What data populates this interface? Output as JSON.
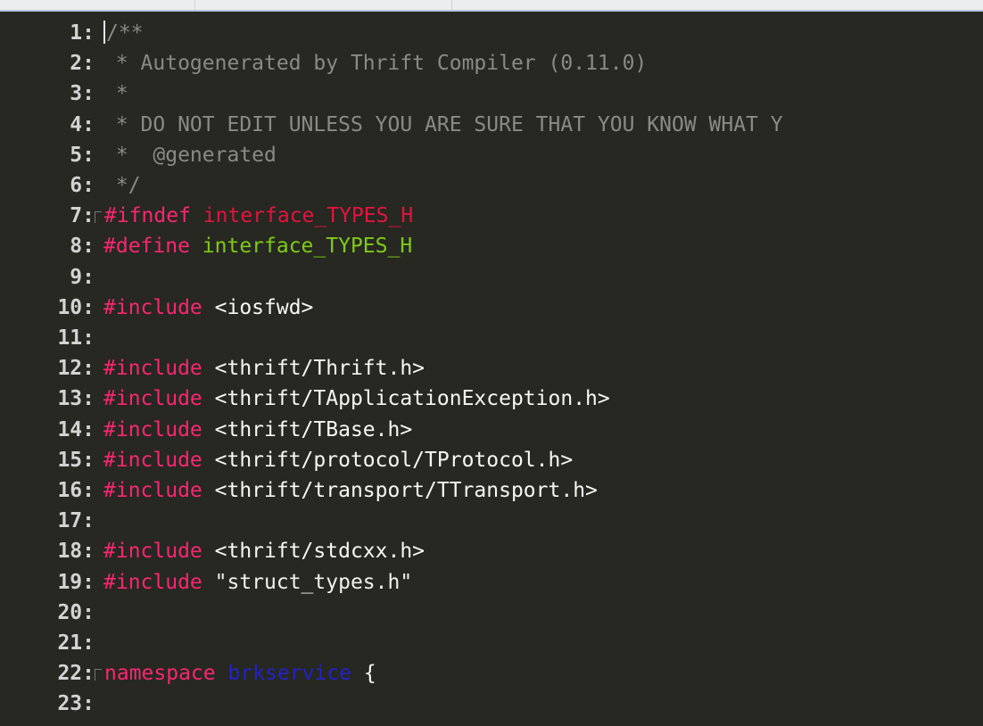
{
  "colors": {
    "background": "#272822",
    "line_number": "#d3d3d3",
    "comment": "#8a8a86",
    "directive": "#f92672",
    "ifndef_name": "#e4143c",
    "define_name": "#7fcb15",
    "namespace_name": "#2222c9",
    "text": "#f8f8f2"
  },
  "editor": {
    "lines": [
      {
        "number": "1:",
        "parts": [
          {
            "text": "/**",
            "style": "comment"
          }
        ]
      },
      {
        "number": "2:",
        "parts": [
          {
            "text": " * Autogenerated by Thrift Compiler (0.11.0)",
            "style": "comment"
          }
        ]
      },
      {
        "number": "3:",
        "parts": [
          {
            "text": " *",
            "style": "comment"
          }
        ]
      },
      {
        "number": "4:",
        "parts": [
          {
            "text": " * DO NOT EDIT UNLESS YOU ARE SURE THAT YOU KNOW WHAT Y",
            "style": "comment"
          }
        ]
      },
      {
        "number": "5:",
        "parts": [
          {
            "text": " *  @generated",
            "style": "comment"
          }
        ]
      },
      {
        "number": "6:",
        "parts": [
          {
            "text": " */",
            "style": "comment"
          }
        ]
      },
      {
        "number": "7:",
        "parts": [
          {
            "text": "#ifndef ",
            "style": "directive"
          },
          {
            "text": "interface_TYPES_H",
            "style": "name-red"
          }
        ]
      },
      {
        "number": "8:",
        "parts": [
          {
            "text": "#define ",
            "style": "directive"
          },
          {
            "text": "interface_TYPES_H",
            "style": "name-green"
          }
        ]
      },
      {
        "number": "9:",
        "parts": []
      },
      {
        "number": "10:",
        "parts": [
          {
            "text": "#include ",
            "style": "directive"
          },
          {
            "text": "<iosfwd>",
            "style": "text"
          }
        ]
      },
      {
        "number": "11:",
        "parts": []
      },
      {
        "number": "12:",
        "parts": [
          {
            "text": "#include ",
            "style": "directive"
          },
          {
            "text": "<thrift/Thrift.h>",
            "style": "text"
          }
        ]
      },
      {
        "number": "13:",
        "parts": [
          {
            "text": "#include ",
            "style": "directive"
          },
          {
            "text": "<thrift/TApplicationException.h>",
            "style": "text"
          }
        ]
      },
      {
        "number": "14:",
        "parts": [
          {
            "text": "#include ",
            "style": "directive"
          },
          {
            "text": "<thrift/TBase.h>",
            "style": "text"
          }
        ]
      },
      {
        "number": "15:",
        "parts": [
          {
            "text": "#include ",
            "style": "directive"
          },
          {
            "text": "<thrift/protocol/TProtocol.h>",
            "style": "text"
          }
        ]
      },
      {
        "number": "16:",
        "parts": [
          {
            "text": "#include ",
            "style": "directive"
          },
          {
            "text": "<thrift/transport/TTransport.h>",
            "style": "text"
          }
        ]
      },
      {
        "number": "17:",
        "parts": []
      },
      {
        "number": "18:",
        "parts": [
          {
            "text": "#include ",
            "style": "directive"
          },
          {
            "text": "<thrift/stdcxx.h>",
            "style": "text"
          }
        ]
      },
      {
        "number": "19:",
        "parts": [
          {
            "text": "#include ",
            "style": "directive"
          },
          {
            "text": "\"struct_types.h\"",
            "style": "string"
          }
        ]
      },
      {
        "number": "20:",
        "parts": []
      },
      {
        "number": "21:",
        "parts": []
      },
      {
        "number": "22:",
        "parts": [
          {
            "text": "namespace ",
            "style": "directive"
          },
          {
            "text": "brkservice",
            "style": "namespace-name"
          },
          {
            "text": " {",
            "style": "text"
          }
        ]
      },
      {
        "number": "23:",
        "parts": []
      }
    ]
  }
}
